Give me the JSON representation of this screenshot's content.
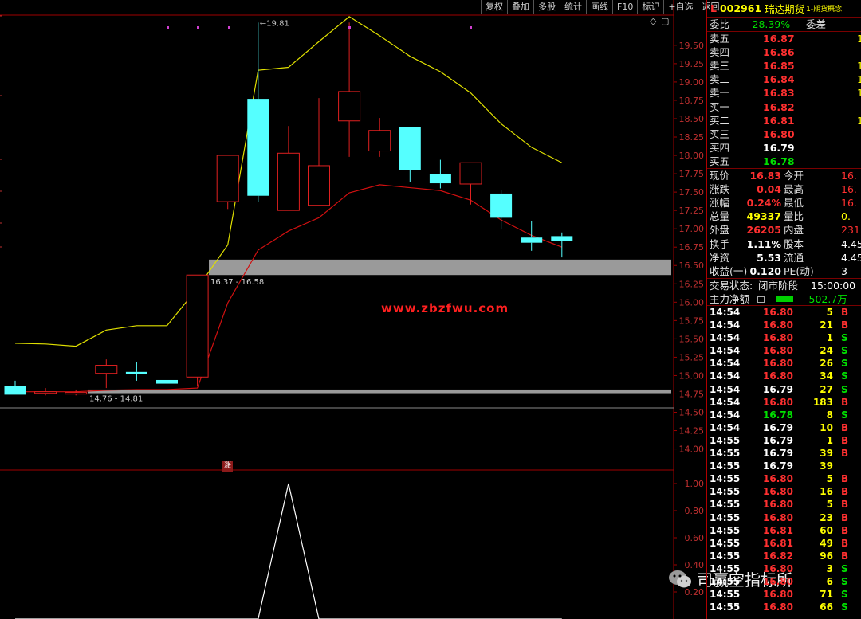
{
  "toolbar": [
    "复权",
    "叠加",
    "多股",
    "统计",
    "画线",
    "F10",
    "标记",
    "+自选",
    "返回"
  ],
  "header": {
    "market": "L",
    "code": "002961",
    "name": "瑞达期货",
    "category": "1-期货概念"
  },
  "quote": {
    "weibi_label": "委比",
    "weibi": "-28.39%",
    "weicha_label": "委差",
    "weicha": "-",
    "asks": [
      {
        "label": "卖五",
        "price": "16.87",
        "vol": "1"
      },
      {
        "label": "卖四",
        "price": "16.86",
        "vol": ""
      },
      {
        "label": "卖三",
        "price": "16.85",
        "vol": "1"
      },
      {
        "label": "卖二",
        "price": "16.84",
        "vol": "1"
      },
      {
        "label": "卖一",
        "price": "16.83",
        "vol": "1"
      }
    ],
    "bids": [
      {
        "label": "买一",
        "price": "16.82",
        "vol": ""
      },
      {
        "label": "买二",
        "price": "16.81",
        "vol": "1"
      },
      {
        "label": "买三",
        "price": "16.80",
        "vol": ""
      },
      {
        "label": "买四",
        "price": "16.79",
        "vol": ""
      },
      {
        "label": "买五",
        "price": "16.78",
        "vol": ""
      }
    ],
    "stats": [
      {
        "l1": "现价",
        "v1": "16.83",
        "l2": "今开",
        "v2": "16."
      },
      {
        "l1": "涨跌",
        "v1": "0.04",
        "l2": "最高",
        "v2": "16."
      },
      {
        "l1": "涨幅",
        "v1": "0.24%",
        "l2": "最低",
        "v2": "16."
      },
      {
        "l1": "总量",
        "v1": "49337",
        "l2": "量比",
        "v2": "0."
      },
      {
        "l1": "外盘",
        "v1": "26205",
        "l2": "内盘",
        "v2": "231"
      }
    ],
    "stats2": [
      {
        "l1": "换手",
        "v1": "1.11%",
        "l2": "股本",
        "v2": "4.45"
      },
      {
        "l1": "净资",
        "v1": "5.53",
        "l2": "流通",
        "v2": "4.45"
      },
      {
        "l1": "收益(一)",
        "v1": "0.120",
        "l2": "PE(动)",
        "v2": "3"
      }
    ],
    "trade_status_label": "交易状态:",
    "trade_status": "闭市阶段",
    "trade_time": "15:00:00",
    "main_force_label": "主力净额",
    "main_force": "-502.7万",
    "main_force_tail": "-"
  },
  "trades": [
    {
      "t": "14:54",
      "p": "16.80",
      "v": "5",
      "d": "B"
    },
    {
      "t": "14:54",
      "p": "16.80",
      "v": "21",
      "d": "B"
    },
    {
      "t": "14:54",
      "p": "16.80",
      "v": "1",
      "d": "S"
    },
    {
      "t": "14:54",
      "p": "16.80",
      "v": "24",
      "d": "S"
    },
    {
      "t": "14:54",
      "p": "16.80",
      "v": "26",
      "d": "S"
    },
    {
      "t": "14:54",
      "p": "16.80",
      "v": "34",
      "d": "S"
    },
    {
      "t": "14:54",
      "p": "16.79",
      "v": "27",
      "d": "S"
    },
    {
      "t": "14:54",
      "p": "16.80",
      "v": "183",
      "d": "B"
    },
    {
      "t": "14:54",
      "p": "16.78",
      "v": "8",
      "d": "S"
    },
    {
      "t": "14:54",
      "p": "16.79",
      "v": "10",
      "d": "B"
    },
    {
      "t": "14:55",
      "p": "16.79",
      "v": "1",
      "d": "B"
    },
    {
      "t": "14:55",
      "p": "16.79",
      "v": "39",
      "d": "B"
    },
    {
      "t": "14:55",
      "p": "16.79",
      "v": "39",
      "d": ""
    },
    {
      "t": "14:55",
      "p": "16.80",
      "v": "5",
      "d": "B"
    },
    {
      "t": "14:55",
      "p": "16.80",
      "v": "16",
      "d": "B"
    },
    {
      "t": "14:55",
      "p": "16.80",
      "v": "5",
      "d": "B"
    },
    {
      "t": "14:55",
      "p": "16.80",
      "v": "23",
      "d": "B"
    },
    {
      "t": "14:55",
      "p": "16.81",
      "v": "60",
      "d": "B"
    },
    {
      "t": "14:55",
      "p": "16.81",
      "v": "49",
      "d": "B"
    },
    {
      "t": "14:55",
      "p": "16.82",
      "v": "96",
      "d": "B"
    },
    {
      "t": "14:55",
      "p": "16.80",
      "v": "3",
      "d": "S"
    },
    {
      "t": "14:55",
      "p": "16.80",
      "v": "6",
      "d": "S"
    },
    {
      "t": "14:55",
      "p": "16.80",
      "v": "71",
      "d": "S"
    },
    {
      "t": "14:55",
      "p": "16.80",
      "v": "66",
      "d": "S"
    }
  ],
  "watermark": "www.zbzfwu.com",
  "wechat_label": "司赢空指标所",
  "zhang_label": "涨",
  "chart_data": {
    "type": "candlestick",
    "main_y_ticks": [
      "19.50",
      "19.25",
      "19.00",
      "18.75",
      "18.50",
      "18.25",
      "18.00",
      "17.75",
      "17.50",
      "17.25",
      "17.00",
      "16.75",
      "16.50",
      "16.25",
      "16.00",
      "15.75",
      "15.50",
      "15.25",
      "15.00",
      "14.75",
      "14.50",
      "14.25",
      "14.00"
    ],
    "main_ylim": [
      13.8,
      19.9
    ],
    "candles": [
      {
        "o": 14.86,
        "c": 14.74,
        "h": 14.93,
        "l": 14.74
      },
      {
        "o": 14.76,
        "c": 14.78,
        "h": 14.83,
        "l": 14.73
      },
      {
        "o": 14.75,
        "c": 14.77,
        "h": 14.81,
        "l": 14.73
      },
      {
        "o": 15.03,
        "c": 15.14,
        "h": 15.22,
        "l": 14.83
      },
      {
        "o": 15.05,
        "c": 15.02,
        "h": 15.18,
        "l": 14.93
      },
      {
        "o": 14.94,
        "c": 14.89,
        "h": 15.08,
        "l": 14.84
      },
      {
        "o": 14.98,
        "c": 16.37,
        "h": 16.37,
        "l": 14.86
      },
      {
        "o": 17.37,
        "c": 18.0,
        "h": 18.0,
        "l": 17.27
      },
      {
        "o": 18.77,
        "c": 17.45,
        "h": 19.81,
        "l": 17.37
      },
      {
        "o": 17.25,
        "c": 18.03,
        "h": 18.4,
        "l": 17.25
      },
      {
        "o": 17.32,
        "c": 17.86,
        "h": 18.78,
        "l": 17.32
      },
      {
        "o": 18.47,
        "c": 18.87,
        "h": 19.81,
        "l": 17.98
      },
      {
        "o": 18.06,
        "c": 18.34,
        "h": 18.51,
        "l": 17.98
      },
      {
        "o": 18.39,
        "c": 17.8,
        "h": 18.39,
        "l": 17.64
      },
      {
        "o": 17.75,
        "c": 17.62,
        "h": 17.94,
        "l": 17.55
      },
      {
        "o": 17.61,
        "c": 17.9,
        "h": 17.9,
        "l": 17.33
      },
      {
        "o": 17.48,
        "c": 17.15,
        "h": 17.53,
        "l": 17.0
      },
      {
        "o": 16.88,
        "c": 16.81,
        "h": 17.1,
        "l": 16.7
      },
      {
        "o": 16.9,
        "c": 16.83,
        "h": 16.95,
        "l": 16.61
      }
    ],
    "ma_yellow": [
      15.44,
      15.43,
      15.4,
      15.62,
      15.68,
      15.68,
      16.19,
      16.78,
      19.16,
      19.2,
      19.55,
      19.89,
      19.63,
      19.35,
      19.14,
      18.85,
      18.43,
      18.11,
      17.9
    ],
    "ma_red": [
      14.78,
      14.78,
      14.78,
      14.8,
      14.81,
      14.81,
      14.83,
      15.99,
      16.71,
      16.97,
      17.15,
      17.49,
      17.6,
      17.56,
      17.52,
      17.39,
      17.12,
      16.91,
      16.75
    ],
    "zones": [
      {
        "lo": 16.37,
        "hi": 16.58,
        "label": "16.37 - 16.58"
      },
      {
        "lo": 14.76,
        "hi": 14.81,
        "label": "14.76 - 14.81"
      }
    ],
    "high_marker": "19.81",
    "sub_y_ticks": [
      "1.00",
      "0.80",
      "0.60",
      "0.40",
      "0.20"
    ],
    "sub_ylim": [
      0,
      1.1
    ],
    "sub_line": [
      0,
      0,
      0,
      0,
      0,
      0,
      0,
      0,
      0,
      1.0,
      0,
      0,
      0,
      0,
      0,
      0,
      0,
      0,
      0
    ]
  }
}
